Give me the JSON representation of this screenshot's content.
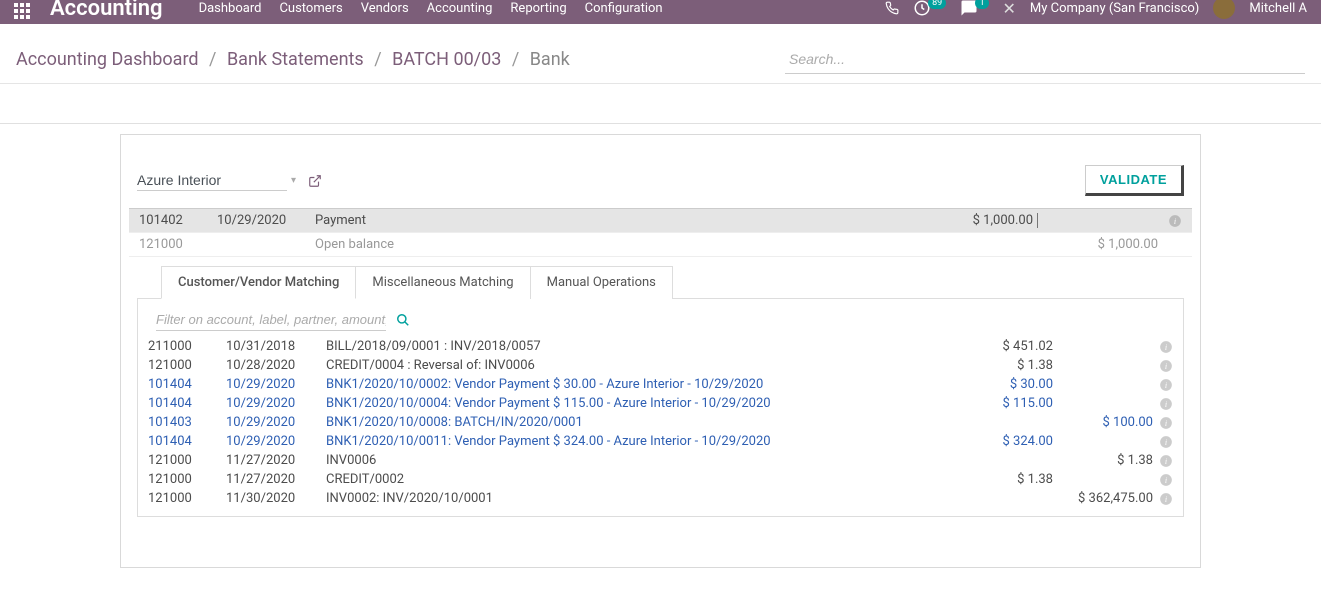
{
  "brand": "Accounting",
  "menu": [
    "Dashboard",
    "Customers",
    "Vendors",
    "Accounting",
    "Reporting",
    "Configuration"
  ],
  "company": "My Company (San Francisco)",
  "user": "Mitchell A",
  "activity_badge": "89",
  "discuss_badge": "1",
  "breadcrumb": {
    "items": [
      "Accounting Dashboard",
      "Bank Statements",
      "BATCH 00/03"
    ],
    "current": "Bank"
  },
  "search_placeholder": "Search...",
  "partner": "Azure Interior",
  "validate_label": "VALIDATE",
  "ledger": [
    {
      "account": "101402",
      "date": "10/29/2020",
      "label": "Payment",
      "debit": "$ 1,000.00",
      "credit": "",
      "selected": true
    },
    {
      "account": "121000",
      "date": "",
      "label": "Open balance",
      "debit": "",
      "credit": "$ 1,000.00",
      "muted": true
    }
  ],
  "tabs": [
    "Customer/Vendor Matching",
    "Miscellaneous Matching",
    "Manual Operations"
  ],
  "active_tab": 0,
  "filter_placeholder": "Filter on account, label, partner, amount,..",
  "matches": [
    {
      "account": "211000",
      "date": "10/31/2018",
      "label": "BILL/2018/09/0001 : INV/2018/0057",
      "debit": "$ 451.02",
      "credit": "",
      "link": false
    },
    {
      "account": "121000",
      "date": "10/28/2020",
      "label": "CREDIT/0004 : Reversal of: INV0006",
      "debit": "$ 1.38",
      "credit": "",
      "link": false
    },
    {
      "account": "101404",
      "date": "10/29/2020",
      "label": "BNK1/2020/10/0002: Vendor Payment $ 30.00 - Azure Interior - 10/29/2020",
      "debit": "$ 30.00",
      "credit": "",
      "link": true
    },
    {
      "account": "101404",
      "date": "10/29/2020",
      "label": "BNK1/2020/10/0004: Vendor Payment $ 115.00 - Azure Interior - 10/29/2020",
      "debit": "$ 115.00",
      "credit": "",
      "link": true
    },
    {
      "account": "101403",
      "date": "10/29/2020",
      "label": "BNK1/2020/10/0008: BATCH/IN/2020/0001",
      "debit": "",
      "credit": "$ 100.00",
      "link": true
    },
    {
      "account": "101404",
      "date": "10/29/2020",
      "label": "BNK1/2020/10/0011: Vendor Payment $ 324.00 - Azure Interior - 10/29/2020",
      "debit": "$ 324.00",
      "credit": "",
      "link": true
    },
    {
      "account": "121000",
      "date": "11/27/2020",
      "label": "INV0006",
      "debit": "",
      "credit": "$ 1.38",
      "link": false
    },
    {
      "account": "121000",
      "date": "11/27/2020",
      "label": "CREDIT/0002",
      "debit": "$ 1.38",
      "credit": "",
      "link": false
    },
    {
      "account": "121000",
      "date": "11/30/2020",
      "label": "INV0002: INV/2020/10/0001",
      "debit": "",
      "credit": "$ 362,475.00",
      "link": false
    }
  ]
}
